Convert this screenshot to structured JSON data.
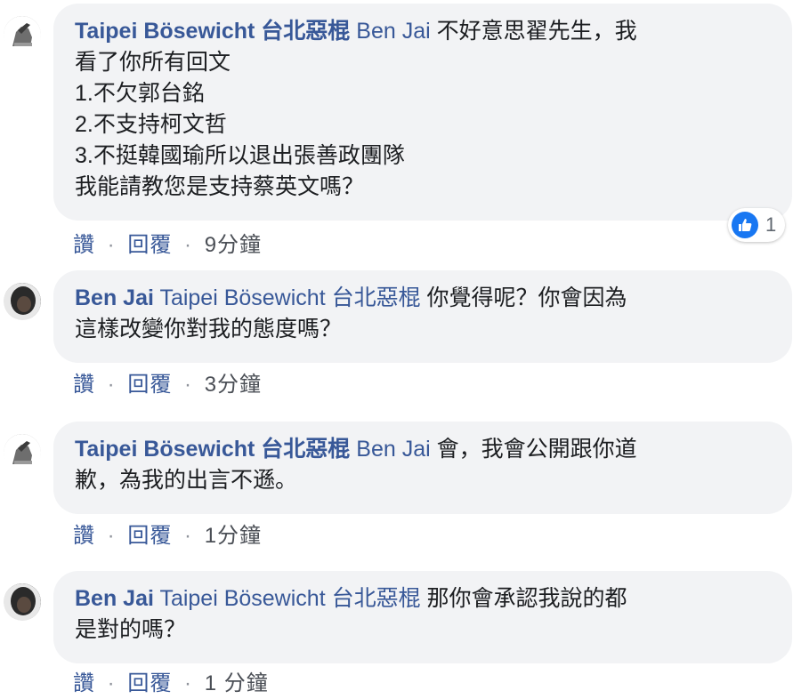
{
  "comments": [
    {
      "author": "Taipei Bösewicht 台北惡棍",
      "mention": "Ben Jai",
      "lines": [
        "不好意思翟先生，我",
        "看了你所有回文",
        "1.不欠郭台銘",
        "2.不支持柯文哲",
        "3.不挺韓國瑜所以退出張善政團隊",
        "我能請教您是支持蔡英文嗎？"
      ],
      "actions": {
        "like": "讚",
        "reply": "回覆",
        "time": "9分鐘"
      },
      "reaction": {
        "icon": "like-icon",
        "count": "1"
      }
    },
    {
      "author": "Ben Jai",
      "mention": "Taipei Bösewicht 台北惡棍",
      "lines": [
        "你覺得呢？你會因為",
        "這樣改變你對我的態度嗎？"
      ],
      "actions": {
        "like": "讚",
        "reply": "回覆",
        "time": "3分鐘"
      }
    },
    {
      "author": "Taipei Bösewicht 台北惡棍",
      "mention": "Ben Jai",
      "lines": [
        "會，我會公開跟你道",
        "歉，為我的出言不遜。"
      ],
      "actions": {
        "like": "讚",
        "reply": "回覆",
        "time": "1分鐘"
      }
    },
    {
      "author": "Ben Jai",
      "mention": "Taipei Bösewicht 台北惡棍",
      "lines": [
        "那你會承認我說的都",
        "是對的嗎？"
      ],
      "actions": {
        "like": "讚",
        "reply": "回覆",
        "time": "1 分鐘"
      }
    }
  ],
  "separator": "·",
  "colors": {
    "link": "#385898",
    "bubble": "#f2f3f5",
    "like_blue": "#1877f2"
  }
}
